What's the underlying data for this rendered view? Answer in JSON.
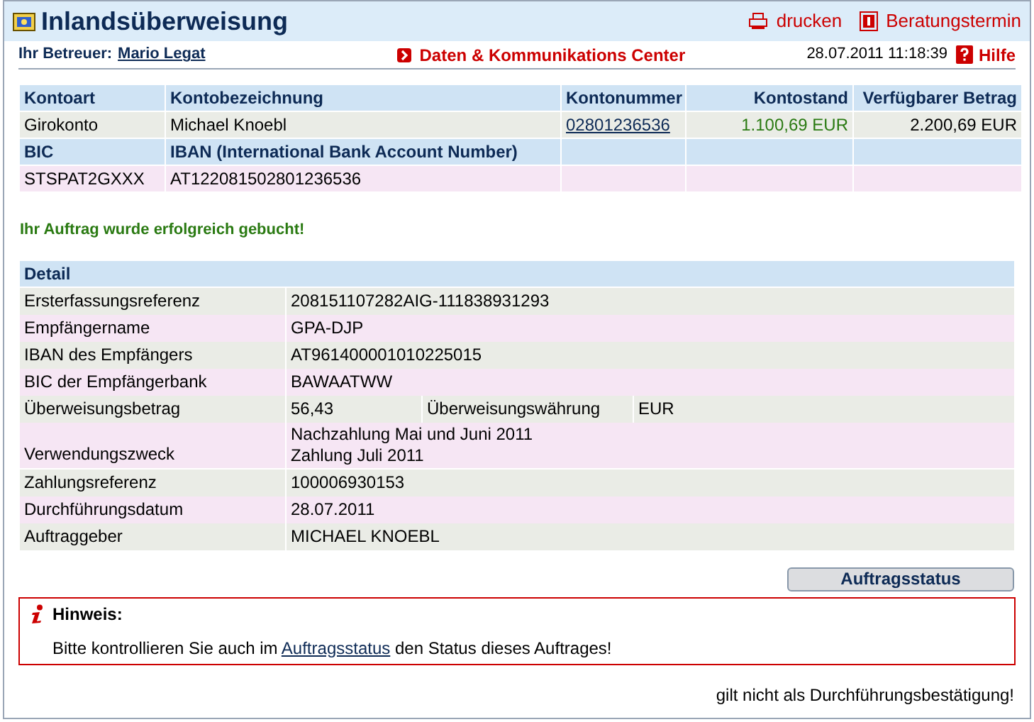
{
  "header": {
    "title": "Inlandsüberweisung",
    "actions": [
      {
        "kind": "print",
        "label": "drucken"
      },
      {
        "kind": "appointment",
        "label": "Beratungstermin"
      }
    ]
  },
  "subheader": {
    "advisor_label": "Ihr Betreuer:",
    "advisor_name": "Mario Legat",
    "center_link": "Daten & Kommunikations Center",
    "datetime": "28.07.2011 11:18:39",
    "help": "Hilfe"
  },
  "account_table": {
    "columns": [
      "Kontoart",
      "Kontobezeichnung",
      "Kontonummer",
      "Kontostand",
      "Verfügbarer Betrag"
    ],
    "row": {
      "type": "Girokonto",
      "name": "Michael Knoebl",
      "number": "02801236536",
      "balance": "1.100,69 EUR",
      "available": "2.200,69 EUR"
    },
    "columns_2": [
      "BIC",
      "IBAN (International Bank Account Number)"
    ],
    "row_2": {
      "bic": "STSPAT2GXXX",
      "iban": "AT122081502801236536"
    }
  },
  "success_message": "Ihr Auftrag wurde erfolgreich gebucht!",
  "detail": {
    "title": "Detail",
    "rows": [
      {
        "label": "Ersterfassungsreferenz",
        "value": "208151107282AIG-111838931293"
      },
      {
        "label": "Empfängername",
        "value": "GPA-DJP"
      },
      {
        "label": "IBAN des Empfängers",
        "value": "AT961400001010225015"
      },
      {
        "label": "BIC der Empfängerbank",
        "value": "BAWAATWW"
      },
      {
        "label": "Überweisungsbetrag",
        "value": "56,43",
        "extra_label": "Überweisungswährung",
        "extra_value": "EUR"
      },
      {
        "label": "Verwendungszweck",
        "lines": [
          "Nachzahlung Mai und Juni 2011",
          "Zahlung Juli 2011"
        ]
      },
      {
        "label": "Zahlungsreferenz",
        "value": "100006930153"
      },
      {
        "label": "Durchführungsdatum",
        "value": "28.07.2011"
      },
      {
        "label": "Auftraggeber",
        "value": "MICHAEL KNOEBL"
      }
    ]
  },
  "status_button": "Auftragsstatus",
  "notice": {
    "title": "Hinweis:",
    "before": "Bitte kontrollieren Sie auch im",
    "link": "Auftragsstatus",
    "after": "den Status dieses Auftrages!"
  },
  "footer_note": "gilt nicht als Durchführungsbestätigung!"
}
